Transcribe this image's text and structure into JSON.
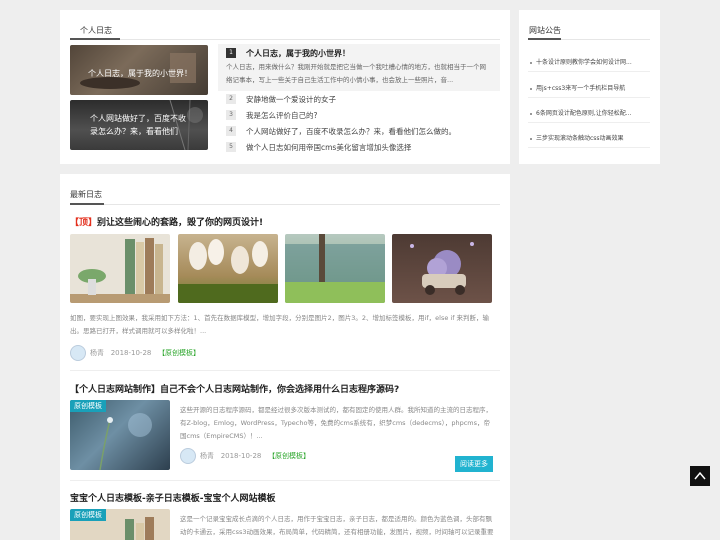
{
  "diary": {
    "title": "个人日志",
    "thumbs": [
      {
        "caption": "个人日志，属于我的小世界！"
      },
      {
        "caption": "个人网站做好了，百度不收录怎么办？来，看看他们怎..."
      }
    ],
    "featured": {
      "num": "1",
      "title": "个人日志，属于我的小世界！",
      "desc": "个人日志，用来做什么？我刚开始就是把它当做一个我吐槽心情的地方，也就相当于一个网络记事本，写上一些关于自己生活工作中的小情小事，也会放上一些照片，音..."
    },
    "list": [
      {
        "num": "2",
        "text": "安静地做一个爱设计的女子"
      },
      {
        "num": "3",
        "text": "我是怎么评价自己的?"
      },
      {
        "num": "4",
        "text": "个人网站做好了，百度不收录怎么办？来，看看他们怎么做的。"
      },
      {
        "num": "5",
        "text": "做个人日志如何用帝国cms美化留言增加头像选择"
      }
    ]
  },
  "notice": {
    "title": "网站公告",
    "items": [
      "十条设计原则教你学会如何设计网...",
      "用js+css3来写一个手机栏目导航",
      "6条网页设计配色原则,让你轻松配...",
      "三步实现滚动条触动css动画效果"
    ]
  },
  "latest": {
    "title": "最新日志",
    "articles": [
      {
        "top_tag": "【顶】",
        "title": "别让这些闹心的套路，毁了你的网页设计!",
        "desc": "如图，要实现上图效果，我采用如下方法：1、首先在数据库模型，增加字段，分别是图片2，图片3。2、增加标签模板，用if，else if 来判断，输出。思路已打开，样式调用就可以多样化啦！...",
        "author": "杨青",
        "date": "2018-10-28",
        "tag": "【原创模板】"
      },
      {
        "title": "【个人日志网站制作】自己不会个人日志网站制作，你会选择用什么日志程序源码?",
        "badge": "原创模板",
        "desc": "这些开源的日志程序源码，都是经过很多次版本测试的，都有固定的使用人群。我所知道的主流的日志程序，有Z-blog，Emlog，WordPress，Typecho等，免费的cms系统有，织梦cms（dedecms），phpcms，帝国cms（EmpireCMS）！...",
        "author": "杨青",
        "date": "2018-10-28",
        "tag": "【原创模板】",
        "more": "阅读更多"
      },
      {
        "title": "宝宝个人日志模板-亲子日志模板-宝宝个人网站模板",
        "badge": "原创模板",
        "desc": "这是一个记录宝宝成长点滴的个人日志，用作于宝宝日志，亲子日志，都是适用的。颜色为蓝色调，头部有飘动的卡通云，采用css3动画效果，布局简单，代码精简，还有相册功能，发图片，视频，时间轴可以记录重要时刻，也可以记录宝宝的点点滴滴，也可以作为家庭日志网站的首页模板..."
      }
    ]
  },
  "backtop": {
    "icon": "chevron-up-icon"
  }
}
